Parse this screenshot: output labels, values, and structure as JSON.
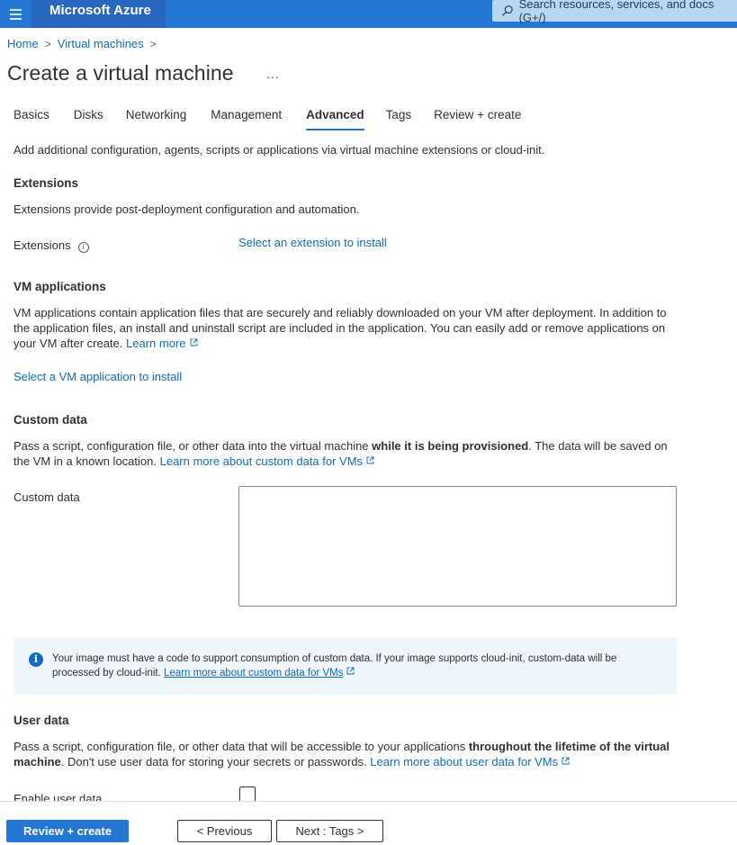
{
  "topbar": {
    "brand": "Microsoft Azure",
    "search_placeholder": "Search resources, services, and docs (G+/)",
    "colors": {
      "bar": "#2478d4",
      "brand_bg": "#2868c0",
      "search_bg": "#b8d6f2"
    }
  },
  "breadcrumb": {
    "items": [
      "Home",
      "Virtual machines"
    ],
    "separator": ">"
  },
  "page": {
    "title": "Create a virtual machine",
    "more_label": "..."
  },
  "tabs": [
    {
      "label": "Basics",
      "active": false
    },
    {
      "label": "Disks",
      "active": false
    },
    {
      "label": "Networking",
      "active": false
    },
    {
      "label": "Management",
      "active": false
    },
    {
      "label": "Advanced",
      "active": true
    },
    {
      "label": "Tags",
      "active": false
    },
    {
      "label": "Review + create",
      "active": false
    }
  ],
  "intro": "Add additional configuration, agents, scripts or applications via virtual machine extensions or cloud-init.",
  "extensions": {
    "heading": "Extensions",
    "description": "Extensions provide post-deployment configuration and automation.",
    "field_label": "Extensions",
    "field_link": "Select an extension to install"
  },
  "vm_applications": {
    "heading": "VM applications",
    "description_line1": "VM applications contain application files that are securely and reliably downloaded on your VM after deployment. In addition to",
    "description_line2": "the application files, an install and uninstall script are included in the application. You can easily add or remove applications on",
    "description_line3": "your VM after create.",
    "learn_more": "Learn more",
    "select_link": "Select a VM application to install"
  },
  "custom_data": {
    "heading": "Custom data",
    "desc_part1": "Pass a script, configuration file, or other data into the virtual machine ",
    "desc_bold": "while it is being provisioned",
    "desc_part2": ". The data will be saved on",
    "desc_line2": "the VM in a known location.",
    "learn_more": "Learn more about custom data for VMs",
    "field_label": "Custom data",
    "field_value": ""
  },
  "info_box": {
    "line1": "Your image must have a code to support consumption of custom data. If your image supports cloud-init, custom-data will be",
    "line2": "processed by cloud-init.",
    "link": "Learn more about custom data for VMs"
  },
  "user_data": {
    "heading": "User data",
    "desc_part1": "Pass a script, configuration file, or other data that will be accessible to your applications ",
    "desc_bold1": "throughout the lifetime of the virtual",
    "desc_bold2": "machine",
    "desc_part2": ". Don't use user data for storing your secrets or passwords.",
    "learn_more": "Learn more about user data for VMs",
    "enable_label": "Enable user data",
    "enabled": false
  },
  "footer": {
    "review_create": "Review + create",
    "previous": "< Previous",
    "next": "Next : Tags >"
  }
}
